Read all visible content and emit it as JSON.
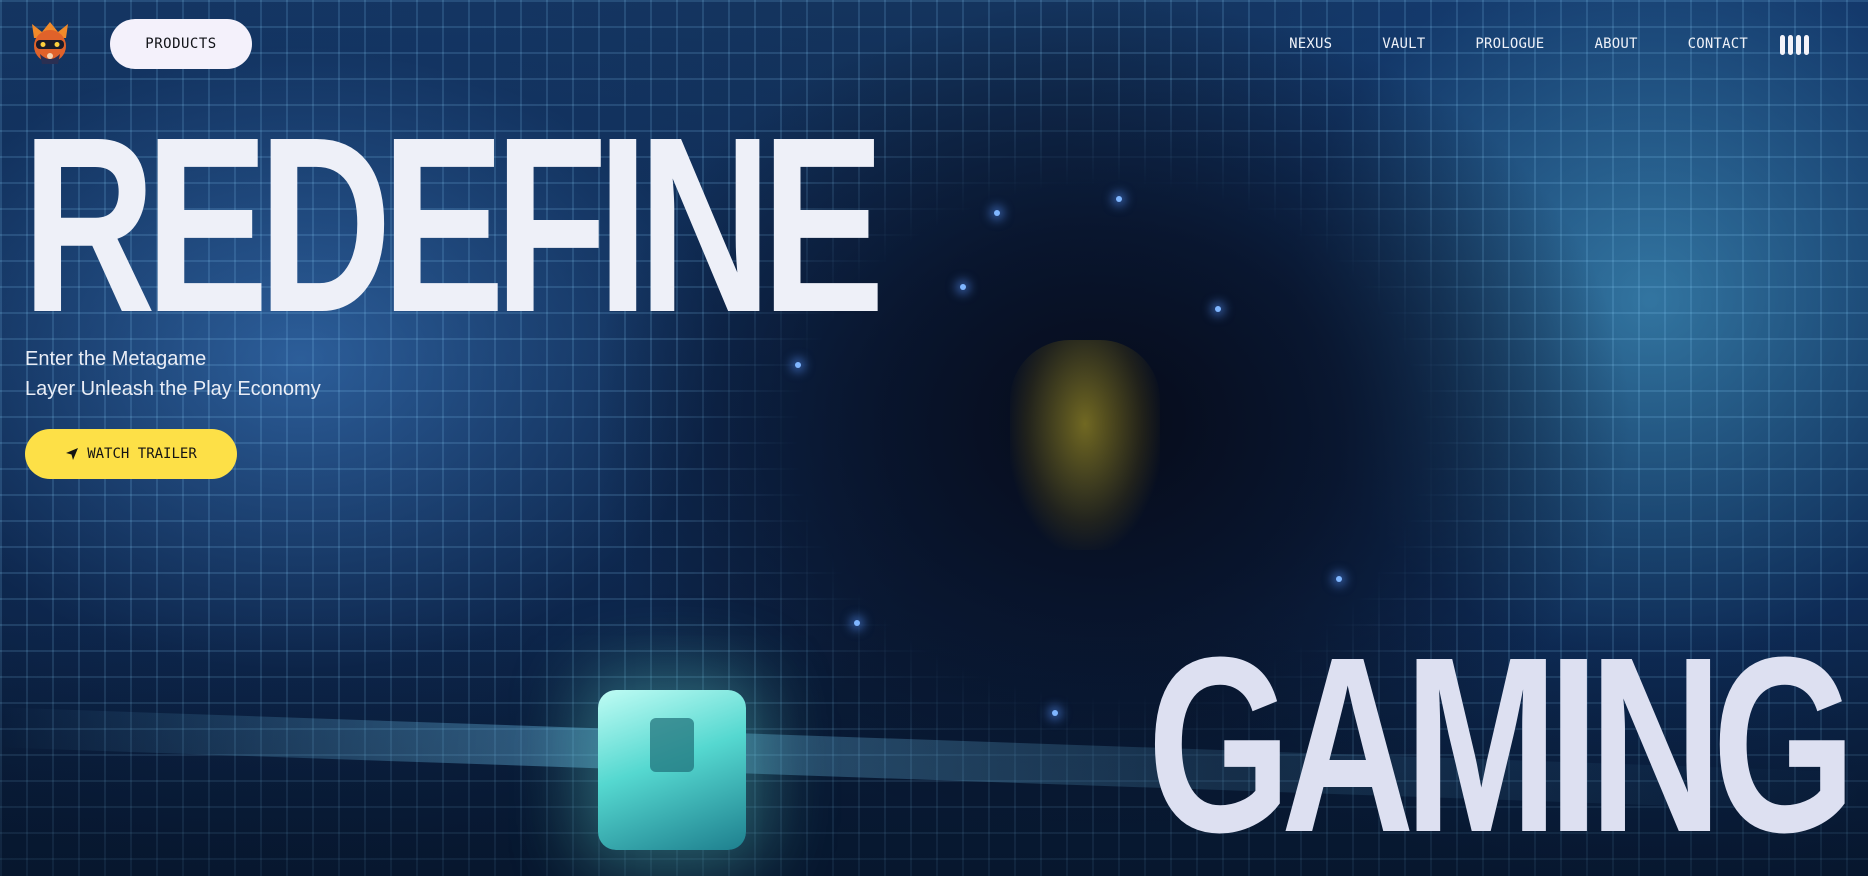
{
  "header": {
    "logo_icon": "gamer-mascot-logo",
    "products_label": "PRODUCTS",
    "nav": [
      {
        "label": "NEXUS"
      },
      {
        "label": "VAULT"
      },
      {
        "label": "PROLOGUE"
      },
      {
        "label": "ABOUT"
      },
      {
        "label": "CONTACT"
      }
    ],
    "audio_icon": "audio-bars-icon"
  },
  "hero": {
    "headline_top": "REDEFINE",
    "subtitle_line1": "Enter the Metagame",
    "subtitle_line2": "Layer Unleash the Play Economy",
    "cta_icon": "location-arrow-icon",
    "cta_label": "WATCH TRAILER",
    "headline_bottom": "GAMING"
  },
  "colors": {
    "accent": "#fde047",
    "headline": "#eef0f8",
    "nav_text": "#eef1f8",
    "products_bg": "#f4f1fb"
  }
}
